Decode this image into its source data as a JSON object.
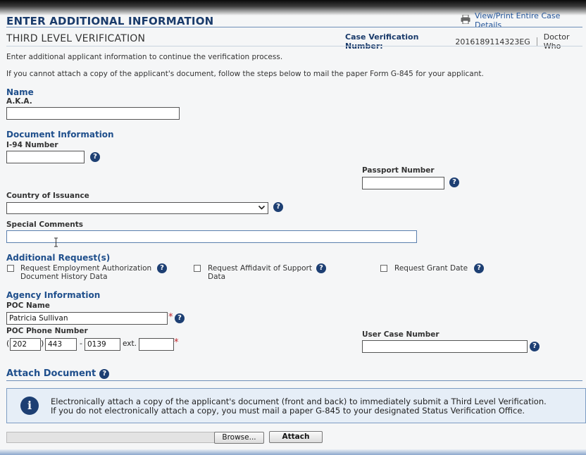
{
  "header": {
    "title": "ENTER ADDITIONAL INFORMATION",
    "print_link": "View/Print Entire Case Details",
    "subtitle": "THIRD LEVEL VERIFICATION",
    "case_label": "Case Verification Number:",
    "case_number": "2016189114323EG",
    "user": "Doctor Who"
  },
  "intro": {
    "line1": "Enter additional applicant information to continue the verification process.",
    "line2": "If you cannot attach a copy of the applicant's document, follow the steps below to mail the paper Form G-845 for your applicant."
  },
  "name_section": {
    "heading": "Name",
    "aka_label": "A.K.A.",
    "aka_value": ""
  },
  "document_section": {
    "heading": "Document Information",
    "i94_label": "I-94 Number",
    "i94_value": "",
    "passport_label": "Passport Number",
    "passport_value": "",
    "country_label": "Country of Issuance",
    "country_value": "",
    "comments_label": "Special Comments",
    "comments_value": ""
  },
  "additional_requests": {
    "heading": "Additional Request(s)",
    "options": [
      {
        "label_line1": "Request Employment Authorization",
        "label_line2": "Document History Data",
        "checked": false
      },
      {
        "label_line1": "Request Affidavit of Support",
        "label_line2": "Data",
        "checked": false
      },
      {
        "label_line1": "Request Grant Date",
        "label_line2": "",
        "checked": false
      }
    ]
  },
  "agency_section": {
    "heading": "Agency Information",
    "poc_name_label": "POC Name",
    "poc_name_value": "Patricia Sullivan",
    "poc_phone_label": "POC Phone Number",
    "phone_area": "202",
    "phone_prefix": "443",
    "phone_line": "0139",
    "ext_label": "ext.",
    "phone_ext": "",
    "user_case_label": "User Case Number",
    "user_case_value": ""
  },
  "attach_section": {
    "heading": "Attach Document",
    "info_line1": "Electronically attach a copy of the applicant's document (front and back) to immediately submit a Third Level Verification.",
    "info_line2": "If you do not electronically attach a copy, you must mail a paper G-845 to your designated Status Verification Office.",
    "browse_label": "Browse...",
    "attach_label": "Attach"
  },
  "icons": {
    "help": "question-mark-icon",
    "info": "info-icon",
    "print": "printer-icon",
    "dropdown": "chevron-down-icon"
  },
  "colors": {
    "heading_blue": "#1f4f8c",
    "title_navy": "#1a3b6b",
    "help_icon": "#1d3f73",
    "required_star": "#c0272d",
    "info_bg": "#e6eef7"
  },
  "glyphs": {
    "help": "?",
    "info": "i",
    "required": "*",
    "chevron": "⌄",
    "open_paren": "(",
    "close_paren": ")",
    "dash": "-"
  }
}
